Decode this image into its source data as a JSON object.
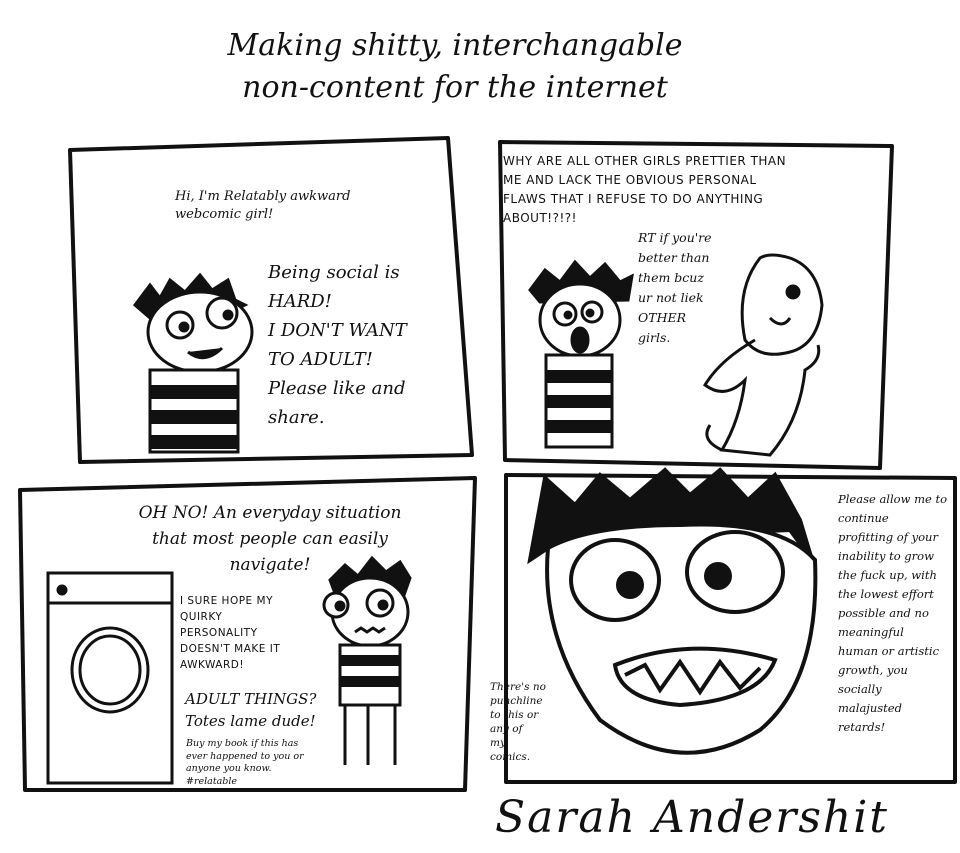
{
  "title": {
    "line1": "Making shitty, interchangable",
    "line2": "non-content for the internet"
  },
  "panel1": {
    "intro": "Hi, I'm Relatably awkward\nwebcomic girl!",
    "rant": "Being social is\nHARD!\nI DON'T WANT\nTO ADULT!\nPlease like and\nshare."
  },
  "panel2": {
    "header": "WHY ARE ALL OTHER GIRLS PRETTIER THAN\nME AND LACK THE OBVIOUS PERSONAL\nFLAWS THAT I REFUSE TO DO ANYTHING\nABOUT!?!?!",
    "rt": "RT if you're\nbetter than\nthem bcuz\nur not liek\nOTHER\ngirls."
  },
  "panel3": {
    "header": "OH NO! An everyday situation\nthat most people can easily\nnavigate!",
    "worry": "I SURE HOPE MY\nQUIRKY\nPERSONALITY\nDOESN'T MAKE IT\nAWKWARD!",
    "adult": "ADULT THINGS?\nTotes lame dude!",
    "book": "Buy my book if this has\never happened to you or\nanyone you know.\n#relatable"
  },
  "panel4": {
    "punchline": "There's no\npunchline\nto this or\nany of\nmy\ncomics.",
    "rant": "Please allow me to\ncontinue\nprofitting of your\ninability to grow\nthe fuck up, with\nthe lowest effort\npossible and no\nmeaningful\nhuman or artistic\ngrowth, you\nsocially\nmalajusted\nretards!"
  },
  "signature": "Sarah Andershit",
  "icons": [
    "girl-face-icon",
    "blonde-girl-icon",
    "washing-machine-icon",
    "big-face-icon"
  ],
  "colors": {
    "ink": "#111111",
    "paper": "#ffffff"
  }
}
